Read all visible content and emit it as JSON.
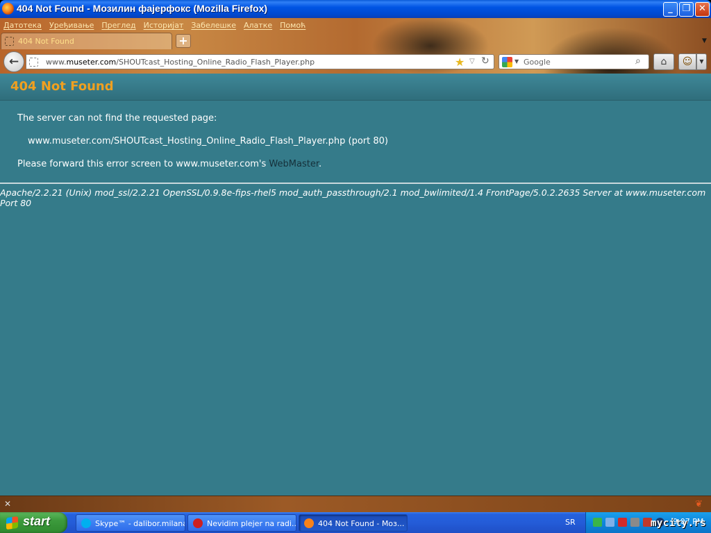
{
  "window": {
    "title": "404 Not Found - Мозилин фајерфокс (Mozilla Firefox)",
    "minimize": "_",
    "maximize": "❐",
    "close": "✕"
  },
  "menu": [
    "Датотека",
    "Уређивање",
    "Преглед",
    "Историјат",
    "Забелешке",
    "Алатке",
    "Помоћ"
  ],
  "tab": {
    "label": "404 Not Found",
    "new_tab": "+"
  },
  "navbar": {
    "url_prefix": "www.",
    "url_domain": "museter.com",
    "url_path": "/SHOUTcast_Hosting_Online_Radio_Flash_Player.php",
    "search_placeholder": "Google"
  },
  "page": {
    "heading": "404 Not Found",
    "line1": "The server can not find the requested page:",
    "line2": "www.museter.com/SHOUTcast_Hosting_Online_Radio_Flash_Player.php (port 80)",
    "line3_prefix": "Please forward this error screen to www.museter.com's ",
    "line3_link": "WebMaster",
    "line3_suffix": ".",
    "server_signature": "Apache/2.2.21 (Unix) mod_ssl/2.2.21 OpenSSL/0.9.8e-fips-rhel5 mod_auth_passthrough/2.1 mod_bwlimited/1.4 FrontPage/5.0.2.2635 Server at www.museter.com Port 80"
  },
  "taskbar": {
    "start_label": "start",
    "tasks": [
      {
        "label": "Skype™ - dalibor.milana",
        "icon": "skype-icon",
        "color": "#00aff0"
      },
      {
        "label": "Nevidim plejer na radi...",
        "icon": "opera-icon",
        "color": "#cc2020"
      },
      {
        "label": "404 Not Found - Моз...",
        "icon": "firefox-icon",
        "color": "#f7821b"
      }
    ],
    "language": "SR",
    "clock": "9:07 PM"
  },
  "watermark": "mycity.rs"
}
